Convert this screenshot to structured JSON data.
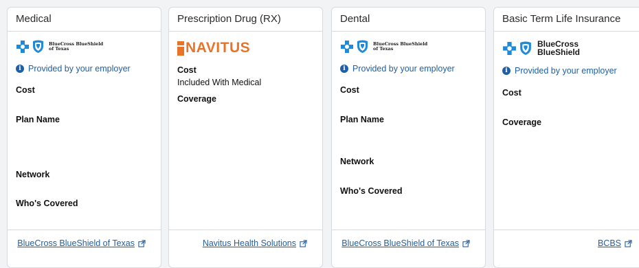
{
  "colors": {
    "link": "#1f5fa5",
    "navitus_orange": "#e8742a",
    "bc_blue": "#1f8ad8",
    "border": "#d7dbe0"
  },
  "cards": [
    {
      "title": "Medical",
      "logo": {
        "type": "bluecross-small",
        "line1": "BlueCross BlueShield",
        "line2": "of Texas"
      },
      "provided_text": "Provided by your employer",
      "fields": [
        "Cost",
        "Plan Name",
        "Network",
        "Who's Covered"
      ],
      "footer_link": "BlueCross BlueShield of Texas"
    },
    {
      "title": "Prescription Drug (RX)",
      "logo": {
        "type": "navitus",
        "text": "NAVITUS"
      },
      "fields": [
        "Cost",
        "Coverage"
      ],
      "cost_value": "Included With Medical",
      "footer_link": "Navitus Health Solutions"
    },
    {
      "title": "Dental",
      "logo": {
        "type": "bluecross-small",
        "line1": "BlueCross BlueShield",
        "line2": "of Texas"
      },
      "provided_text": "Provided by your employer",
      "fields": [
        "Cost",
        "Plan Name",
        "Network",
        "Who's Covered"
      ],
      "footer_link": "BlueCross BlueShield of Texas"
    },
    {
      "title": "Basic Term Life Insurance",
      "logo": {
        "type": "bluecross-large",
        "line1": "BlueCross",
        "line2": "BlueShield"
      },
      "provided_text": "Provided by your employer",
      "fields": [
        "Cost",
        "Coverage"
      ],
      "footer_link": "BCBS"
    }
  ],
  "icons": {
    "info": "info-circle-icon",
    "external": "external-link-icon",
    "cross": "blue-cross-icon",
    "shield": "blue-shield-icon"
  }
}
